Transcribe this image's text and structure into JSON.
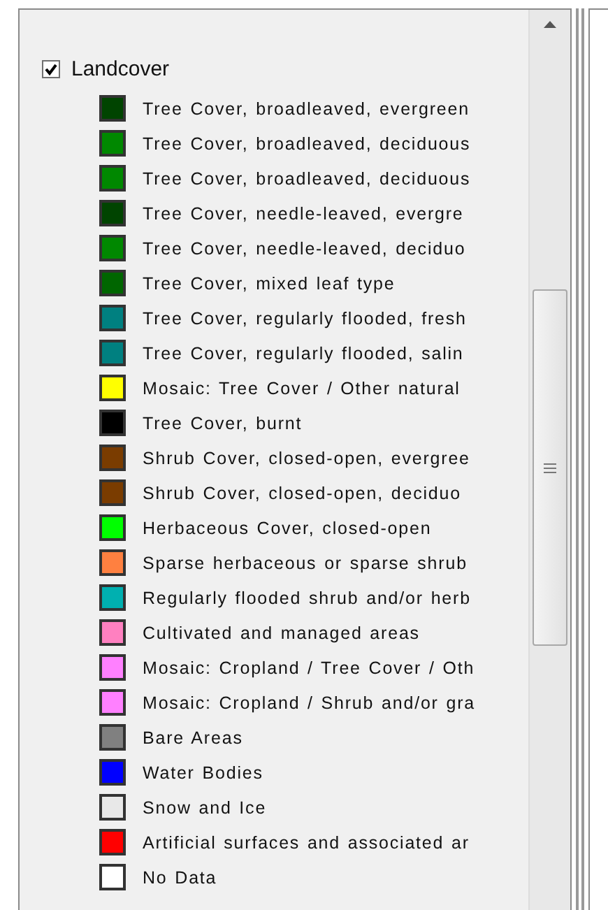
{
  "layer": {
    "label": "Landcover",
    "checked": true
  },
  "items": [
    {
      "label": "Tree Cover, broadleaved, evergreen",
      "color": "#004400"
    },
    {
      "label": "Tree Cover, broadleaved, deciduous",
      "color": "#008800"
    },
    {
      "label": "Tree Cover, broadleaved, deciduous",
      "color": "#008800"
    },
    {
      "label": "Tree Cover, needle-leaved, evergre",
      "color": "#004400"
    },
    {
      "label": "Tree Cover, needle-leaved, deciduo",
      "color": "#008800"
    },
    {
      "label": "Tree Cover, mixed leaf type",
      "color": "#006600"
    },
    {
      "label": "Tree Cover, regularly flooded, fresh",
      "color": "#008080"
    },
    {
      "label": "Tree Cover, regularly flooded, salin",
      "color": "#008080"
    },
    {
      "label": "Mosaic: Tree Cover / Other natural",
      "color": "#ffff00"
    },
    {
      "label": "Tree Cover, burnt",
      "color": "#000000"
    },
    {
      "label": "Shrub Cover, closed-open, evergree",
      "color": "#7a3c00"
    },
    {
      "label": "Shrub Cover, closed-open, deciduo",
      "color": "#7a3c00"
    },
    {
      "label": "Herbaceous Cover, closed-open",
      "color": "#00ff00"
    },
    {
      "label": "Sparse herbaceous or sparse shrub",
      "color": "#ff8040"
    },
    {
      "label": "Regularly flooded shrub and/or herb",
      "color": "#00b0b0"
    },
    {
      "label": "Cultivated and managed areas",
      "color": "#ff80c0"
    },
    {
      "label": "Mosaic: Cropland / Tree Cover / Oth",
      "color": "#ff80ff"
    },
    {
      "label": "Mosaic: Cropland / Shrub and/or gra",
      "color": "#ff80ff"
    },
    {
      "label": "Bare Areas",
      "color": "#808080"
    },
    {
      "label": "Water Bodies",
      "color": "#0000ff"
    },
    {
      "label": "Snow and Ice",
      "color": "#e8e8e8"
    },
    {
      "label": "Artificial surfaces and associated ar",
      "color": "#ff0000"
    },
    {
      "label": "No Data",
      "color": "#ffffff"
    }
  ]
}
